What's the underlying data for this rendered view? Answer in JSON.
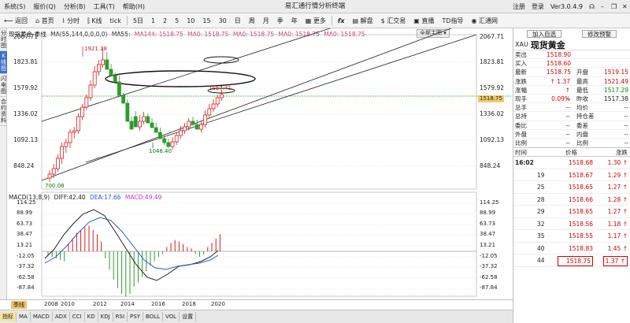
{
  "menu": {
    "items": [
      "系统(S)",
      "报价(Q)",
      "分析(B)",
      "工具(T)",
      "帮助(H)"
    ],
    "title": "易汇通行情分析终端",
    "right": [
      "注册",
      "登录",
      "Ver3.0.4.9"
    ]
  },
  "toolbar": {
    "items": [
      "返回",
      "首页",
      "分时",
      "K线",
      "tick",
      "5日",
      "1",
      "2",
      "5",
      "10",
      "15",
      "30",
      "日",
      "周",
      "月",
      "季",
      "年",
      "更多",
      "fx",
      "解盘",
      "汇交易",
      "直播",
      "TD指导",
      "汇通网"
    ]
  },
  "left_tabs": [
    "分时图",
    "K线图",
    "闪电图",
    "合约资料"
  ],
  "chart": {
    "symbol": "现货黄金-季线",
    "ma_text": "MA(55,144,0,0,0,0)",
    "ma_items": [
      {
        "label": "MA55: ",
        "color": "#000000"
      },
      {
        "label": "MA144: 1518.75",
        "color": "#d04080"
      },
      {
        "label": "MA0: 1518.75",
        "color": "#d04080"
      },
      {
        "label": "MA0: 1518.75",
        "color": "#d04080"
      },
      {
        "label": "MA0: 1518.75",
        "color": "#d04080"
      },
      {
        "label": "MA0: 1518.75",
        "color": "#d04080"
      }
    ],
    "left_axis": [
      "2067.71",
      "1823.81",
      "1579.92",
      "1336.02",
      "1092.13",
      "848.24"
    ],
    "right_axis": [
      "2067.71",
      "1823.81",
      "1579.92",
      "1336.02",
      "1092.13",
      "848.24"
    ],
    "current_price": "1518.75",
    "callouts": {
      "high": "1921.18",
      "low_mid": "1046.40",
      "low": "700.08",
      "last": "1557.41"
    },
    "full_chart_label": "全部主图",
    "macd_legend": {
      "name": "MACD(13,8,9)",
      "diff": "DIFF:42.40",
      "dea": "DEA:17.66",
      "macd": "MACD:49.49"
    },
    "macd_left_axis": [
      "114.25",
      "88.99",
      "63.73",
      "38.47",
      "13.21",
      "-12.05",
      "-37.32",
      "-62.58",
      "-87.84"
    ],
    "macd_right_axis": [
      "114.25",
      "88.99",
      "63.73",
      "38.47",
      "13.21",
      "-12.05",
      "-37.32",
      "-62.58",
      "-87.84"
    ],
    "x_labels": [
      "2008",
      "2010",
      "2012",
      "2014",
      "2016",
      "2018",
      "2020"
    ],
    "period_label": "季线",
    "bottom_tabs": [
      "指标",
      "MA",
      "MACD",
      "ADX",
      "CCI",
      "KD",
      "KDJ",
      "RSI",
      "PSY",
      "BOLL",
      "VOL",
      "设置"
    ]
  },
  "panel": {
    "buttons": [
      "加入自选",
      "修改预警"
    ],
    "code": "XAU",
    "name": "现货黄金",
    "quote": [
      {
        "l": "卖出",
        "v": "1518.90",
        "c": "red",
        "l2": "",
        "v2": ""
      },
      {
        "l": "买入",
        "v": "1518.60",
        "c": "red",
        "l2": "",
        "v2": ""
      },
      {
        "l": "最新",
        "v": "1518.75",
        "c": "red",
        "l2": "开盘",
        "v2": "1519.15",
        "c2": "red"
      },
      {
        "l": "涨跌",
        "v": "↑ 1.37",
        "c": "red",
        "l2": "最高",
        "v2": "1521.49",
        "c2": "red"
      },
      {
        "l": "涨幅",
        "v": "↑ 0.09%",
        "c": "red",
        "l2": "最低",
        "v2": "1517.29",
        "c2": "green"
      },
      {
        "l": "现手",
        "v": "--",
        "c": "",
        "l2": "昨收",
        "v2": "1517.38",
        "c2": ""
      },
      {
        "l": "总手",
        "v": "--",
        "c": "",
        "l2": "均价",
        "v2": "--",
        "c2": ""
      },
      {
        "l": "总持",
        "v": "--",
        "c": "",
        "l2": "持仓差",
        "v2": "--",
        "c2": ""
      },
      {
        "l": "委比",
        "v": "--",
        "c": "",
        "l2": "委差",
        "v2": "--",
        "c2": ""
      },
      {
        "l": "外盘",
        "v": "--",
        "c": "",
        "l2": "内盘",
        "v2": "--",
        "c2": ""
      },
      {
        "l": "比例",
        "v": "--",
        "c": "",
        "l2": "比例",
        "v2": "--",
        "c2": ""
      }
    ],
    "tick_headers": [
      "时间",
      "价格",
      "涨跌"
    ],
    "ticks": [
      {
        "t": "16:02",
        "p": "1518.68",
        "d": "1.30 ↑"
      },
      {
        "t": "19",
        "p": "1518.67",
        "d": "1.29 ↑"
      },
      {
        "t": "25",
        "p": "1518.65",
        "d": "1.27 ↑"
      },
      {
        "t": "28",
        "p": "1518.66",
        "d": "1.28 ↑"
      },
      {
        "t": "29",
        "p": "1518.65",
        "d": "1.27 ↑"
      },
      {
        "t": "32",
        "p": "1518.56",
        "d": "1.18 ↑"
      },
      {
        "t": "35",
        "p": "1518.55",
        "d": "1.17 ↑"
      },
      {
        "t": "40",
        "p": "1518.83",
        "d": "1.45 ↑"
      },
      {
        "t": "44",
        "p": "1518.75",
        "d": "1.37 ↑"
      }
    ]
  }
}
